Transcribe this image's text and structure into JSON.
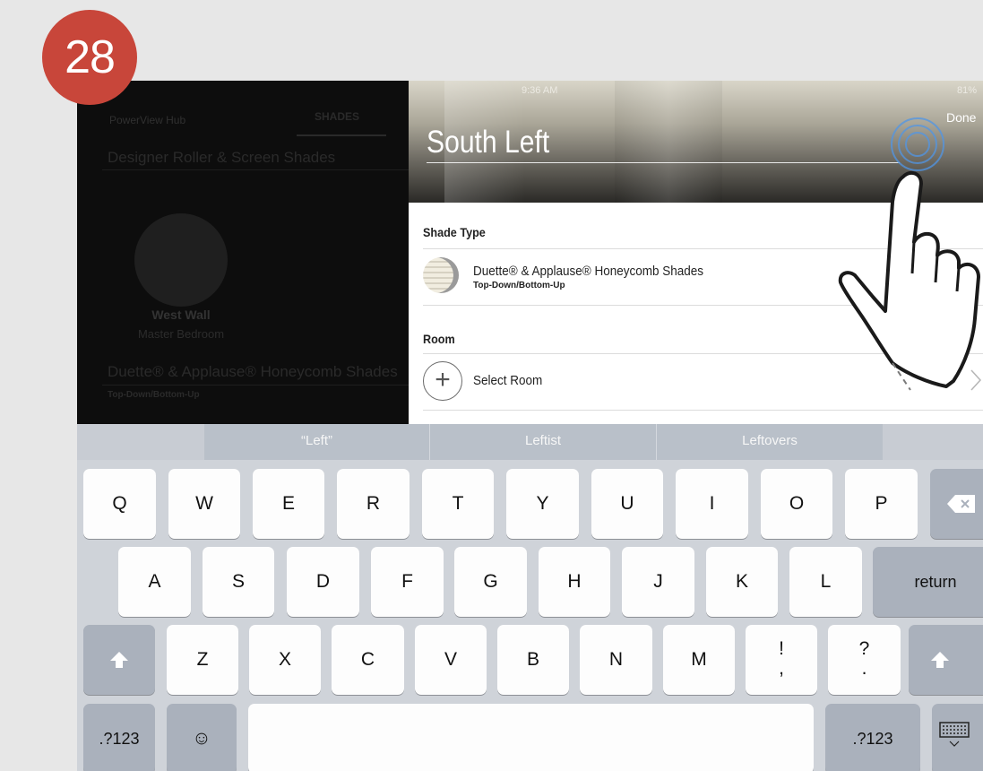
{
  "step_badge": "28",
  "left_panel": {
    "hub_title": "PowerView Hub",
    "tab_label": "SHADES",
    "section1_title": "Designer Roller & Screen Shades",
    "shade_name": "West Wall",
    "shade_room": "Master Bedroom",
    "section2_title": "Duette® & Applause® Honeycomb Shades",
    "section2_sub": "Top-Down/Bottom-Up"
  },
  "header": {
    "status_time": "9:36 AM",
    "status_battery": "81%",
    "done_label": "Done",
    "shade_name_value": "South Left"
  },
  "form": {
    "shade_type_label": "Shade Type",
    "shade_type_value": "Duette® & Applause® Honeycomb Shades",
    "shade_type_sub": "Top-Down/Bottom-Up",
    "room_label": "Room",
    "room_value": "Select Room"
  },
  "keyboard": {
    "suggestions": [
      "“Left”",
      "Leftist",
      "Leftovers"
    ],
    "row1": [
      "Q",
      "W",
      "E",
      "R",
      "T",
      "Y",
      "U",
      "I",
      "O",
      "P"
    ],
    "row2": [
      "A",
      "S",
      "D",
      "F",
      "G",
      "H",
      "J",
      "K",
      "L"
    ],
    "row3": [
      "Z",
      "X",
      "C",
      "V",
      "B",
      "N",
      "M"
    ],
    "punct1_top": "!",
    "punct1_bottom": ",",
    "punct2_top": "?",
    "punct2_bottom": ".",
    "return_label": "return",
    "numbers_label": ".?123",
    "emoji_label": "☺"
  },
  "colors": {
    "badge": "#c8463a",
    "keyboard_bg": "#cfd3d9",
    "key_dark": "#aab1bc"
  }
}
